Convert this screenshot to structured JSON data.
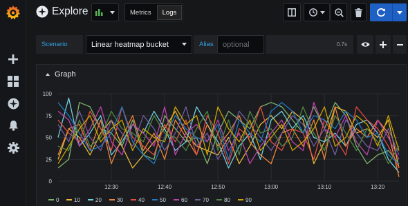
{
  "app": {
    "title": "Explore"
  },
  "sidebar": {
    "items": [
      {
        "icon": "plus-icon",
        "label": "Create"
      },
      {
        "icon": "dashboards-grid-icon",
        "label": "Dashboards"
      },
      {
        "icon": "compass-icon",
        "label": "Explore"
      },
      {
        "icon": "bell-icon",
        "label": "Alerting"
      },
      {
        "icon": "gear-icon",
        "label": "Configuration"
      }
    ]
  },
  "toolbar": {
    "modes": [
      "Metrics",
      "Logs"
    ],
    "active_mode": "Logs"
  },
  "query": {
    "scenario_label": "Scenario",
    "scenario_value": "Linear heatmap bucket",
    "alias_label": "Alias",
    "alias_placeholder": "optional",
    "duration": "0.7s"
  },
  "panel": {
    "title": "Graph"
  },
  "colors": {
    "accent": "#1f60c4",
    "label_blue": "#33a2e5"
  },
  "chart_data": {
    "type": "line",
    "x": [
      "12:20",
      "12:22",
      "12:24",
      "12:26",
      "12:28",
      "12:30",
      "12:32",
      "12:34",
      "12:36",
      "12:38",
      "12:40",
      "12:42",
      "12:44",
      "12:46",
      "12:48",
      "12:50",
      "12:52",
      "12:54",
      "12:56",
      "12:58",
      "13:00",
      "13:02",
      "13:04",
      "13:06",
      "13:08",
      "13:10",
      "13:12",
      "13:14",
      "13:16",
      "13:18",
      "13:20",
      "13:22",
      "13:24"
    ],
    "xticks": [
      "12:30",
      "12:40",
      "12:50",
      "13:00",
      "13:10",
      "13:20"
    ],
    "yticks": [
      "0",
      "25",
      "50",
      "75",
      "100"
    ],
    "ylim": [
      0,
      100
    ],
    "grid": true,
    "legend_position": "bottom",
    "series": [
      {
        "name": "0",
        "color": "#7eb26d",
        "values": [
          15,
          25,
          90,
          85,
          60,
          55,
          40,
          70,
          30,
          25,
          75,
          60,
          45,
          50,
          20,
          55,
          80,
          70,
          60,
          85,
          90,
          85,
          70,
          55,
          85,
          60,
          90,
          75,
          40,
          20,
          30,
          35,
          20
        ]
      },
      {
        "name": "10",
        "color": "#eab839",
        "values": [
          25,
          60,
          50,
          30,
          55,
          70,
          40,
          15,
          30,
          45,
          60,
          80,
          55,
          40,
          35,
          30,
          50,
          20,
          40,
          65,
          75,
          60,
          80,
          70,
          20,
          45,
          85,
          80,
          55,
          60,
          50,
          70,
          15
        ]
      },
      {
        "name": "20",
        "color": "#6ed0e0",
        "values": [
          50,
          95,
          40,
          55,
          75,
          30,
          45,
          65,
          55,
          80,
          60,
          35,
          45,
          85,
          65,
          45,
          15,
          40,
          55,
          25,
          70,
          80,
          60,
          75,
          50,
          45,
          55,
          40,
          65,
          70,
          55,
          25,
          10
        ]
      },
      {
        "name": "30",
        "color": "#ef843c",
        "values": [
          30,
          60,
          65,
          35,
          70,
          20,
          50,
          75,
          35,
          55,
          25,
          70,
          50,
          30,
          65,
          40,
          55,
          75,
          45,
          30,
          20,
          55,
          60,
          40,
          70,
          25,
          85,
          40,
          60,
          50,
          70,
          55,
          5
        ]
      },
      {
        "name": "40",
        "color": "#e24d42",
        "values": [
          70,
          55,
          45,
          80,
          60,
          35,
          85,
          50,
          40,
          30,
          65,
          45,
          70,
          30,
          75,
          55,
          20,
          60,
          50,
          85,
          45,
          35,
          60,
          55,
          25,
          70,
          50,
          30,
          85,
          70,
          60,
          40,
          15
        ]
      },
      {
        "name": "50",
        "color": "#1f78c1",
        "values": [
          90,
          75,
          55,
          35,
          40,
          55,
          85,
          45,
          30,
          20,
          50,
          75,
          60,
          50,
          45,
          65,
          25,
          70,
          55,
          45,
          80,
          90,
          80,
          55,
          75,
          70,
          60,
          80,
          70,
          50,
          55,
          30,
          20
        ]
      },
      {
        "name": "60",
        "color": "#ba43a9",
        "values": [
          80,
          70,
          40,
          60,
          85,
          45,
          30,
          65,
          55,
          40,
          85,
          30,
          55,
          65,
          45,
          70,
          35,
          55,
          20,
          40,
          55,
          70,
          45,
          35,
          90,
          60,
          50,
          75,
          45,
          30,
          70,
          50,
          25
        ]
      },
      {
        "name": "70",
        "color": "#705da0",
        "values": [
          65,
          45,
          80,
          50,
          35,
          70,
          55,
          40,
          75,
          60,
          35,
          55,
          85,
          40,
          55,
          25,
          45,
          80,
          65,
          50,
          35,
          55,
          75,
          65,
          40,
          60,
          30,
          70,
          55,
          40,
          35,
          60,
          30
        ]
      },
      {
        "name": "80",
        "color": "#508642",
        "values": [
          40,
          35,
          70,
          40,
          50,
          80,
          60,
          55,
          45,
          75,
          55,
          50,
          35,
          60,
          80,
          35,
          70,
          30,
          80,
          55,
          60,
          40,
          50,
          85,
          55,
          35,
          75,
          55,
          35,
          60,
          45,
          20,
          40
        ]
      },
      {
        "name": "90",
        "color": "#cca300",
        "values": [
          20,
          40,
          60,
          75,
          45,
          60,
          70,
          35,
          60,
          50,
          45,
          85,
          65,
          75,
          30,
          85,
          60,
          45,
          70,
          35,
          50,
          65,
          35,
          45,
          60,
          85,
          40,
          50,
          75,
          65,
          40,
          75,
          35
        ]
      }
    ]
  }
}
